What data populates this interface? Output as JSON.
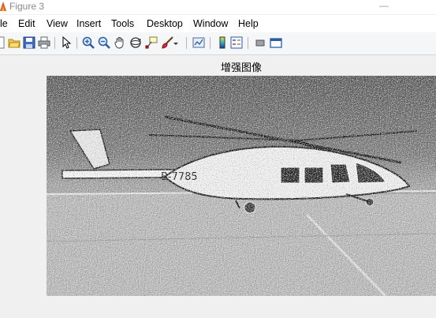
{
  "window": {
    "title": "Figure 3",
    "minimize_glyph": "—"
  },
  "menu": {
    "items": [
      {
        "label": "le",
        "name": "menu-file"
      },
      {
        "label": "Edit",
        "name": "menu-edit"
      },
      {
        "label": "View",
        "name": "menu-view"
      },
      {
        "label": "Insert",
        "name": "menu-insert"
      },
      {
        "label": "Tools",
        "name": "menu-tools"
      },
      {
        "label": "Desktop",
        "name": "menu-desktop"
      },
      {
        "label": "Window",
        "name": "menu-window"
      },
      {
        "label": "Help",
        "name": "menu-help"
      }
    ]
  },
  "toolbar": {
    "buttons": [
      "new-figure-icon",
      "open-file-icon",
      "save-icon",
      "print-icon",
      "edit-plot-arrow-icon",
      "zoom-in-icon",
      "zoom-out-icon",
      "pan-hand-icon",
      "rotate-3d-icon",
      "data-cursor-icon",
      "brush-icon",
      "brush-dropdown-icon",
      "link-plot-icon",
      "insert-colorbar-icon",
      "insert-legend-icon",
      "hide-plot-tools-icon",
      "show-plot-tools-icon"
    ]
  },
  "axes": {
    "title": "增强图像",
    "image_description_label": "B-7785"
  },
  "colors": {
    "window_bg": "#f0f0f0",
    "menubar_bg": "#ffffff",
    "toolbar_bg": "#f5f6f7"
  }
}
